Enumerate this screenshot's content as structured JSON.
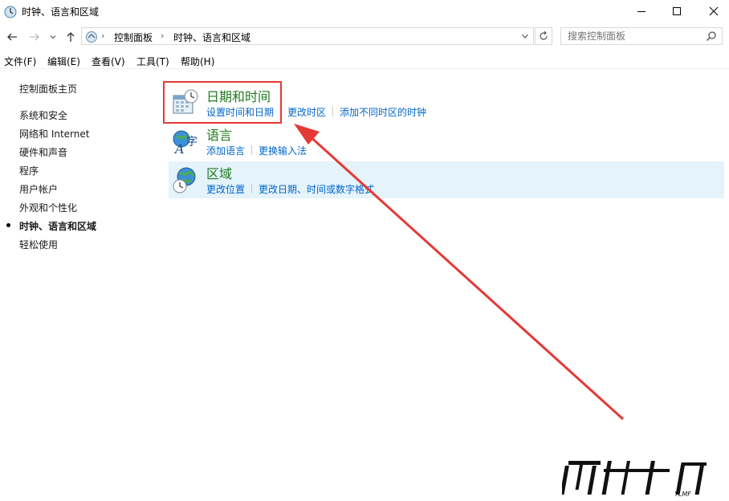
{
  "window": {
    "title": "时钟、语言和区域",
    "icons": {
      "app": "clock-globe-icon",
      "minimize": "minimize-icon",
      "maximize": "maximize-icon",
      "close": "close-icon"
    }
  },
  "nav": {
    "icons": [
      "back-arrow-icon",
      "forward-arrow-icon",
      "recent-dropdown-icon",
      "up-arrow-icon"
    ],
    "breadcrumb": [
      "控制面板",
      "时钟、语言和区域"
    ],
    "search_placeholder": "搜索控制面板"
  },
  "menu": [
    "文件(F)",
    "编辑(E)",
    "查看(V)",
    "工具(T)",
    "帮助(H)"
  ],
  "sidebar": {
    "items": [
      {
        "label": "控制面板主页",
        "current": false
      },
      {
        "label": "系统和安全",
        "current": false
      },
      {
        "label": "网络和 Internet",
        "current": false
      },
      {
        "label": "硬件和声音",
        "current": false
      },
      {
        "label": "程序",
        "current": false
      },
      {
        "label": "用户帐户",
        "current": false
      },
      {
        "label": "外观和个性化",
        "current": false
      },
      {
        "label": "时钟、语言和区域",
        "current": true
      },
      {
        "label": "轻松使用",
        "current": false
      }
    ]
  },
  "categories": [
    {
      "title": "日期和时间",
      "icon": "calendar-clock-icon",
      "links": [
        "设置时间和日期",
        "更改时区",
        "添加不同时区的时钟"
      ]
    },
    {
      "title": "语言",
      "icon": "language-icon",
      "links": [
        "添加语言",
        "更换输入法"
      ]
    },
    {
      "title": "区域",
      "icon": "globe-clock-icon",
      "links": [
        "更改位置",
        "更改日期、时间或数字格式"
      ]
    }
  ],
  "colors": {
    "category_title": "#1e7b1e",
    "link": "#0066cc",
    "selected_row": "#e5f3fb",
    "annotation": "#e53935"
  },
  "watermark": {
    "brand": "雨林木风",
    "latin": "YLMF"
  }
}
